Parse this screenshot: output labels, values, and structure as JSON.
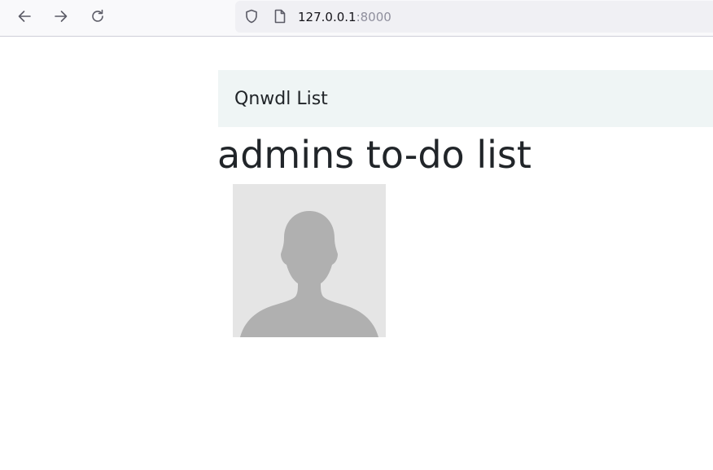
{
  "browser": {
    "url_host": "127.0.0.1",
    "url_port": ":8000",
    "icons": [
      "arrow-left-icon",
      "arrow-right-icon",
      "reload-icon",
      "shield-icon",
      "page-icon"
    ]
  },
  "navbar": {
    "brand": "Qnwdl List",
    "background": "#eff5f5"
  },
  "main": {
    "title": "admins to-do list",
    "avatar_icon": "user-silhouette-icon"
  },
  "colors": {
    "text": "#212529",
    "avatar_bg": "#e5e5e5",
    "avatar_fg": "#b0b0b0"
  }
}
